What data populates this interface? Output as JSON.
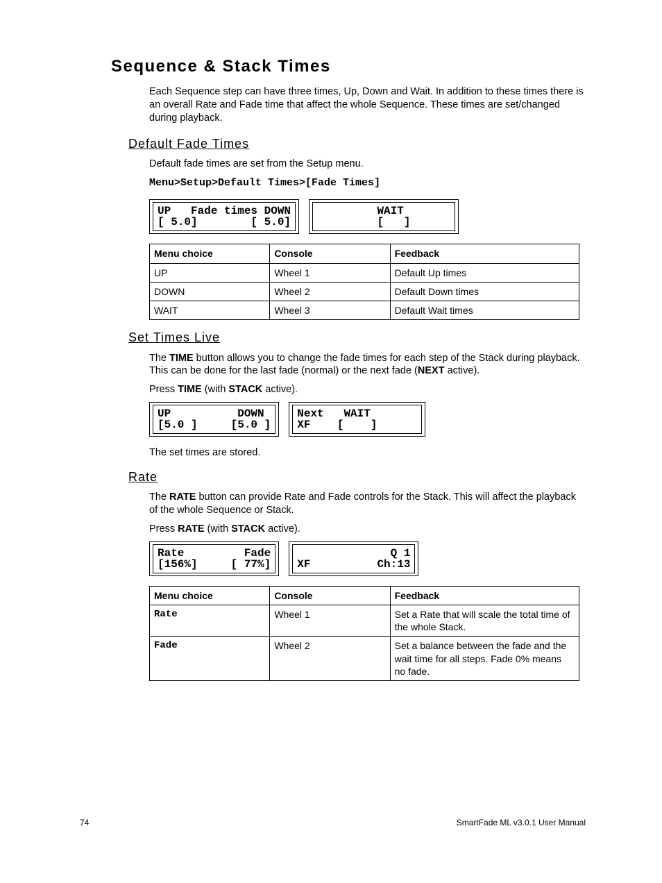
{
  "title": "Sequence & Stack Times",
  "intro": "Each Sequence step can have three times, Up, Down and Wait. In addition to these times there is an overall Rate and Fade time that affect the whole Sequence. These times are set/changed during playback.",
  "section1": {
    "heading": "Default Fade Times",
    "p1": "Default fade times are set from the Setup menu.",
    "menupath": "Menu>Setup>Default Times>[Fade Times]",
    "lcd1a": "UP   Fade times DOWN\n[ 5.0]        [ 5.0]",
    "lcd1b": "         WAIT       \n         [   ]      ",
    "table": {
      "h1": "Menu choice",
      "h2": "Console",
      "h3": "Feedback",
      "r1c1": "UP",
      "r1c2": "Wheel 1",
      "r1c3": "Default Up times",
      "r2c1": "DOWN",
      "r2c2": "Wheel 2",
      "r2c3": "Default Down times",
      "r3c1": "WAIT",
      "r3c2": "Wheel 3",
      "r3c3": "Default Wait times"
    }
  },
  "section2": {
    "heading": "Set Times Live",
    "p_pre": "The ",
    "p_b1": "TIME",
    "p_mid": " button allows you to change the fade times for each step of the Stack during playback. This can be done for the last fade (normal) or the next fade (",
    "p_b2": "NEXT",
    "p_post": " active).",
    "press_pre": "Press ",
    "press_b1": "TIME",
    "press_mid": " (with ",
    "press_b2": "STACK",
    "press_post": " active).",
    "lcd2a": "UP          DOWN\n[5.0 ]     [5.0 ]",
    "lcd2b": "Next   WAIT       \nXF    [    ]      ",
    "tail": "The set times are stored."
  },
  "section3": {
    "heading": "Rate",
    "p_pre": "The ",
    "p_b1": "RATE",
    "p_post": " button can provide Rate and Fade controls for the Stack. This will affect the playback of the whole Sequence or Stack.",
    "press_pre": "Press ",
    "press_b1": "RATE",
    "press_mid": " (with ",
    "press_b2": "STACK",
    "press_post": " active).",
    "lcd3a": "Rate         Fade\n[156%]     [ 77%]",
    "lcd3b": "              Q 1\nXF          Ch:13",
    "table": {
      "h1": "Menu choice",
      "h2": "Console",
      "h3": "Feedback",
      "r1c1": "Rate",
      "r1c2": "Wheel 1",
      "r1c3": "Set a Rate that will scale the total time of the whole Stack.",
      "r2c1": "Fade",
      "r2c2": "Wheel 2",
      "r2c3": "Set a balance between the fade and the wait time for all steps. Fade 0% means no fade."
    }
  },
  "footer": {
    "page": "74",
    "manual": "SmartFade ML v3.0.1 User Manual"
  }
}
